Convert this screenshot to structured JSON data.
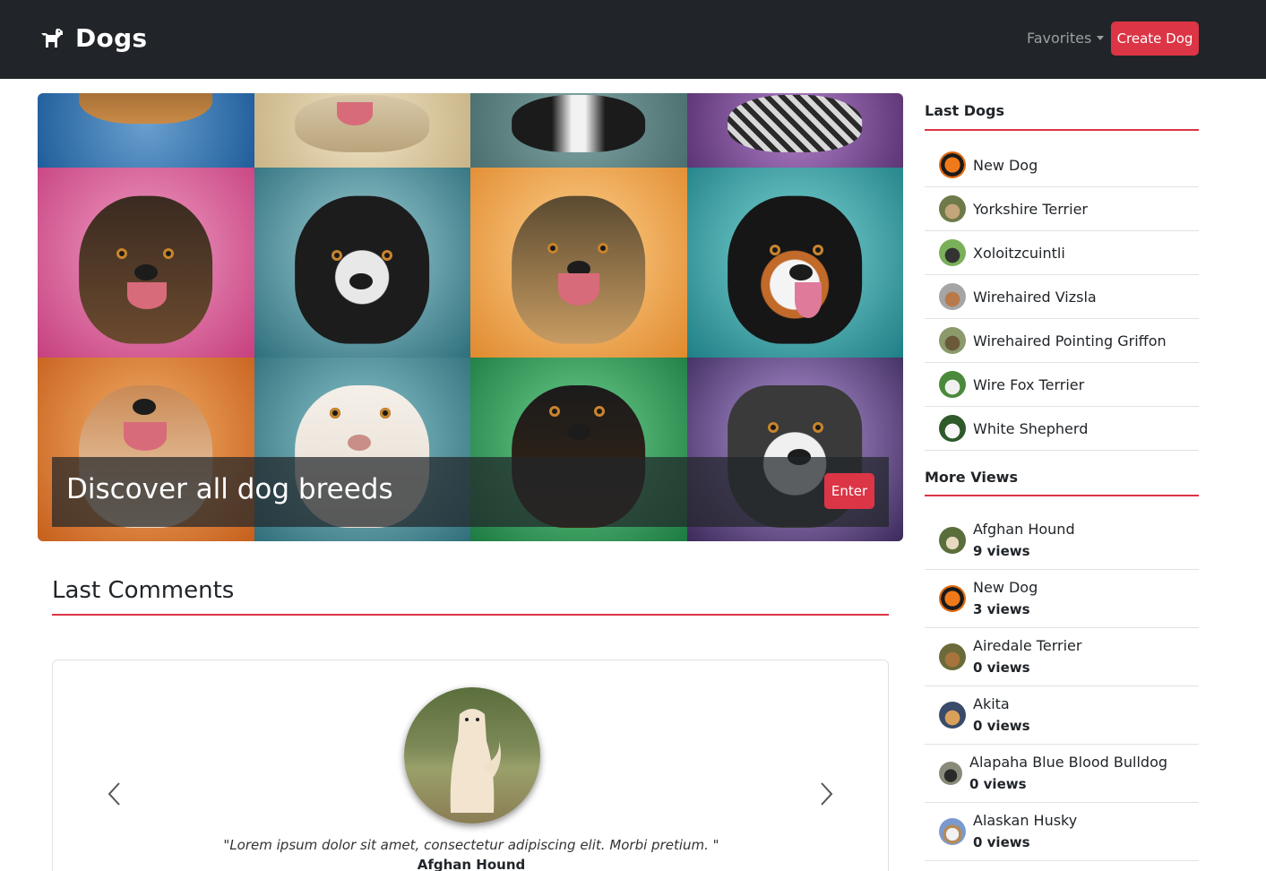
{
  "navbar": {
    "brand": "Dogs",
    "brand_icon": "dog-icon",
    "favorites_label": "Favorites",
    "create_label": "Create Dog"
  },
  "hero": {
    "title": "Discover all dog breeds",
    "enter_label": "Enter"
  },
  "comments": {
    "title": "Last Comments",
    "quote": "\"Lorem ipsum dolor sit amet, consectetur adipiscing elit. Morbi pretium. \"",
    "author": "Afghan Hound"
  },
  "sidebar": {
    "last_dogs_title": "Last Dogs",
    "last_dogs": [
      {
        "name": "New Dog"
      },
      {
        "name": "Yorkshire Terrier"
      },
      {
        "name": "Xoloitzcuintli"
      },
      {
        "name": "Wirehaired Vizsla"
      },
      {
        "name": "Wirehaired Pointing Griffon"
      },
      {
        "name": "Wire Fox Terrier"
      },
      {
        "name": "White Shepherd"
      }
    ],
    "more_views_title": "More Views",
    "more_views": [
      {
        "name": "Afghan Hound",
        "views": "9 views"
      },
      {
        "name": "New Dog",
        "views": "3 views"
      },
      {
        "name": "Airedale Terrier",
        "views": "0 views"
      },
      {
        "name": "Akita",
        "views": "0 views"
      },
      {
        "name": "Alapaha Blue Blood Bulldog",
        "views": "0 views"
      },
      {
        "name": "Alaskan Husky",
        "views": "0 views"
      }
    ]
  },
  "colors": {
    "navbar": "#212529",
    "accent": "#dc3545"
  }
}
